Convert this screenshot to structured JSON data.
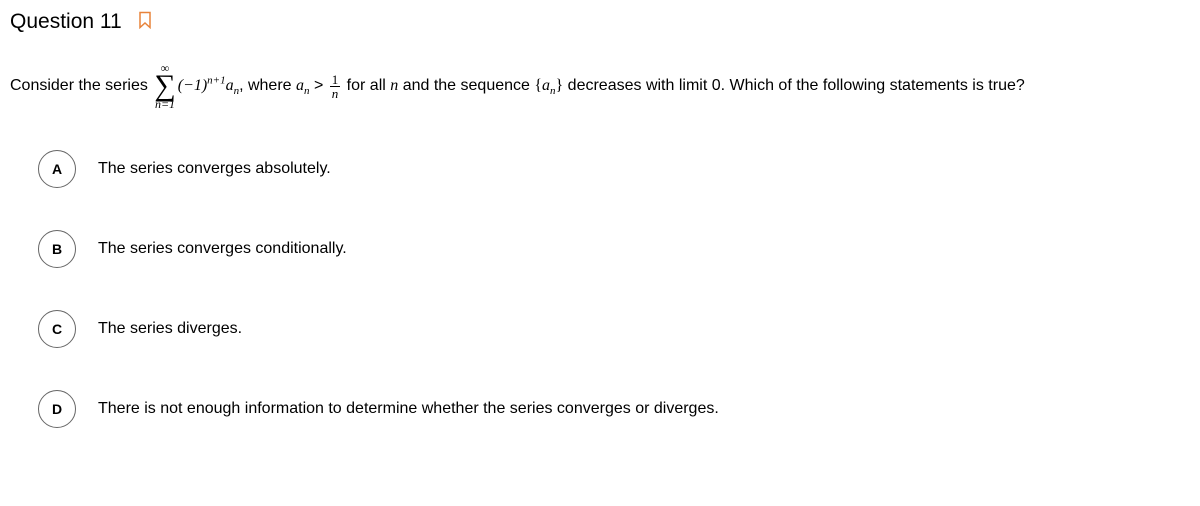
{
  "header": {
    "title": "Question 11"
  },
  "prompt": {
    "lead": "Consider the series ",
    "sum_top": "∞",
    "sum_bottom": "n=1",
    "term_part1": "(−1)",
    "term_exp": "n+1",
    "term_part2": "a",
    "term_sub": "n",
    "comma_where": ", where ",
    "an": "a",
    "an_sub": "n",
    "gt": " > ",
    "frac_top": "1",
    "frac_bot": "n",
    "for_all": " for all ",
    "nvar": "n",
    "and_seq": " and the sequence ",
    "brace_open": "{",
    "seq_a": "a",
    "seq_sub": "n",
    "brace_close": "}",
    "tail": " decreases with limit 0. Which of the following statements is true?"
  },
  "options": [
    {
      "letter": "A",
      "text": "The series converges absolutely."
    },
    {
      "letter": "B",
      "text": "The series converges conditionally."
    },
    {
      "letter": "C",
      "text": "The series diverges."
    },
    {
      "letter": "D",
      "text": "There is not enough information to determine whether the series converges or diverges."
    }
  ]
}
